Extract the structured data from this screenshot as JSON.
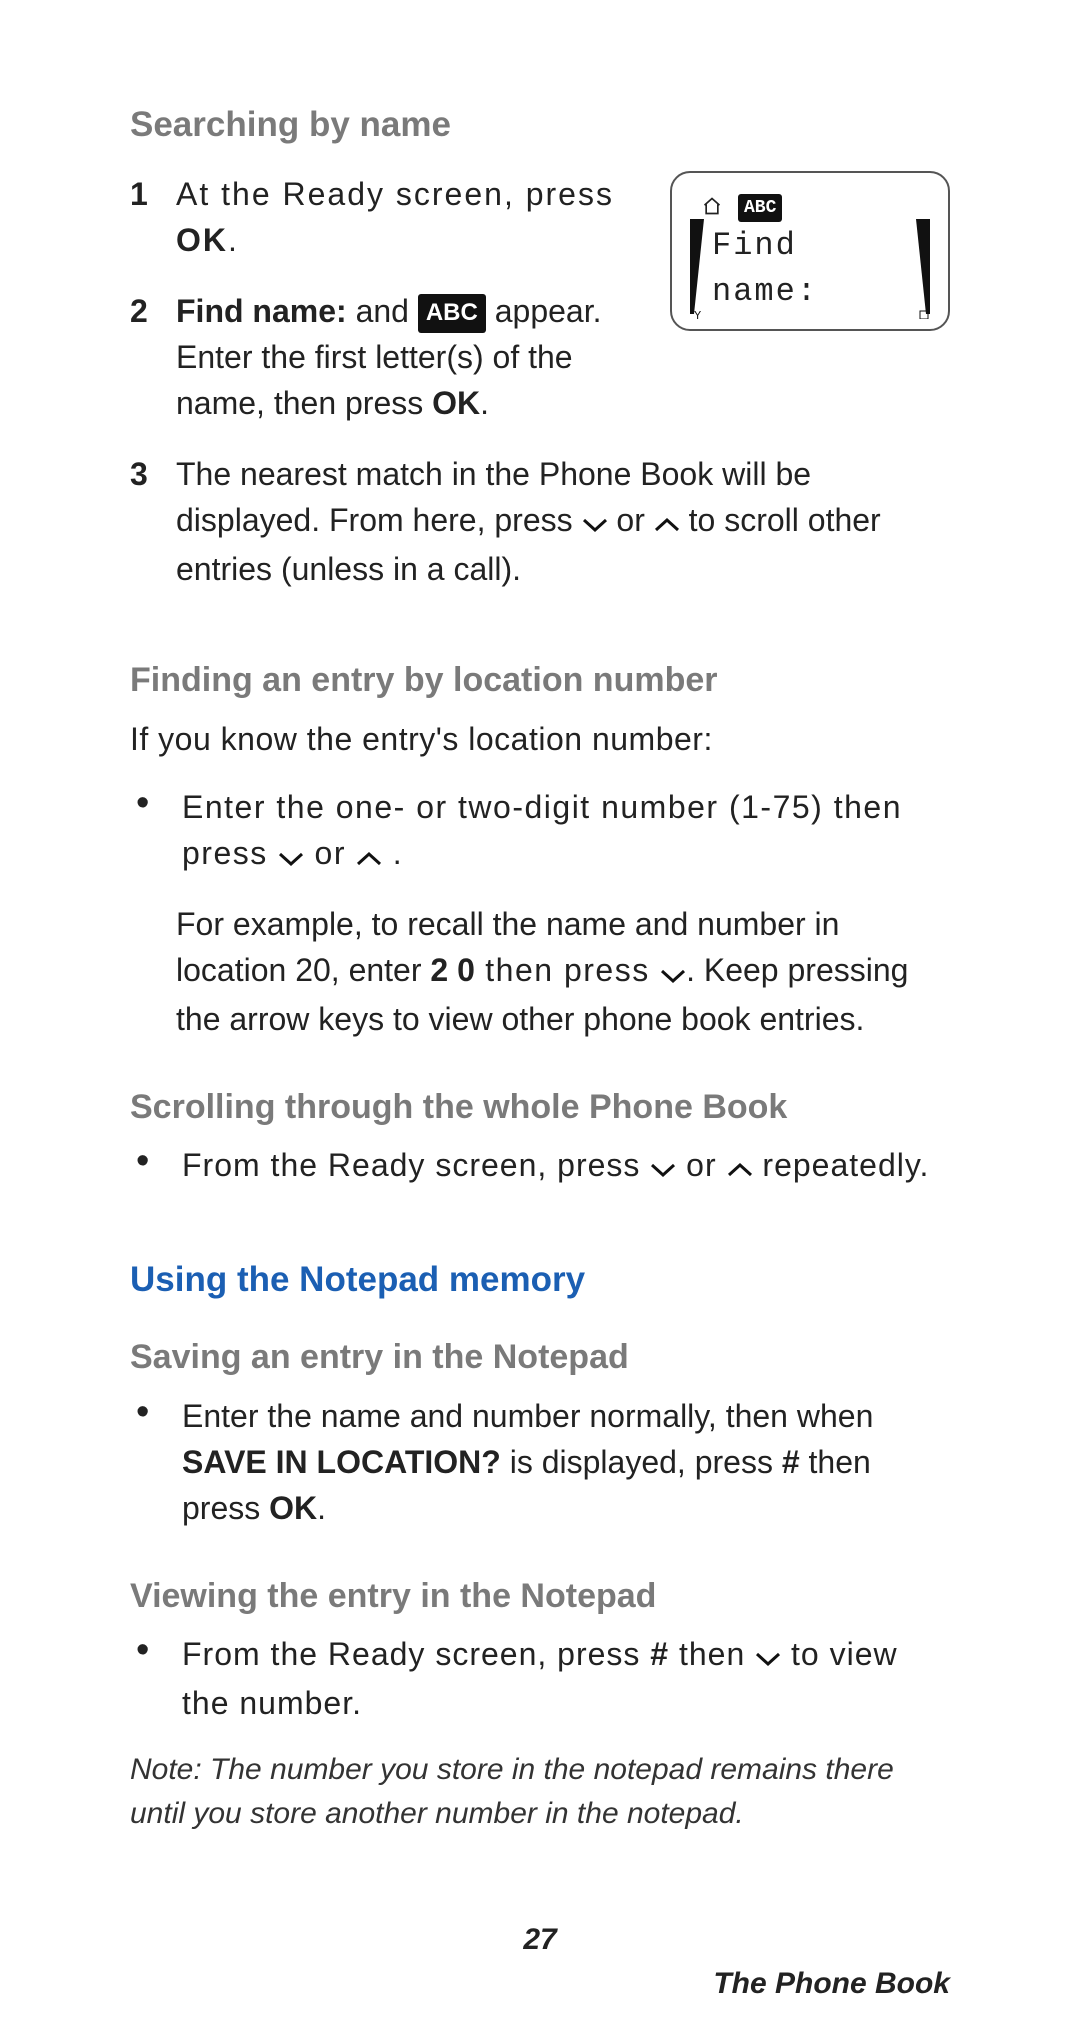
{
  "section1": {
    "title": "Searching by name",
    "step1_a": "At the Ready screen, press ",
    "step1_b": "OK",
    "step1_c": ".",
    "step2_a": "Find name:",
    "step2_b": " and ",
    "step2_badge": "ABC",
    "step2_c": " appear. Enter the first letter(s) of the name, then press ",
    "step2_d": "OK",
    "step2_e": ".",
    "step3_a": "The nearest match in the Phone Book will be displayed. From here, press ",
    "step3_b": " or ",
    "step3_c": " to scroll other entries (unless in a call)."
  },
  "phone": {
    "title": "Find name:",
    "abc": "ABC"
  },
  "section2": {
    "title": "Finding an entry by location number",
    "intro": "If you know the entry's location number:",
    "b1_a": "Enter the one- or two-digit number (1-75) then press ",
    "b1_b": " or ",
    "b1_c": ".",
    "p2_a": "For example, to recall the name and number in location 20, enter ",
    "p2_b": "2 0",
    "p2_c": " then press ",
    "p2_d": ". Keep pressing the arrow keys to view other phone book entries."
  },
  "section3": {
    "title": "Scrolling through the whole Phone Book",
    "b1_a": "From the Ready screen, press ",
    "b1_b": " or ",
    "b1_c": " repeatedly."
  },
  "section4": {
    "title": "Using the Notepad memory",
    "sub1": "Saving an entry in the Notepad",
    "s1_a": "Enter the name and number normally, then when ",
    "s1_b": "SAVE IN LOCATION?",
    "s1_c": " is displayed, press ",
    "s1_d": "#",
    "s1_e": " then press ",
    "s1_f": "OK",
    "s1_g": ".",
    "sub2": "Viewing the entry in the Notepad",
    "s2_a": "From the Ready screen, press ",
    "s2_b": "#",
    "s2_c": " then ",
    "s2_d": " to view the number.",
    "note": "Note: The number you store in the notepad remains there until you store another number in the notepad."
  },
  "page_number": "27",
  "section_footer": "The Phone Book"
}
